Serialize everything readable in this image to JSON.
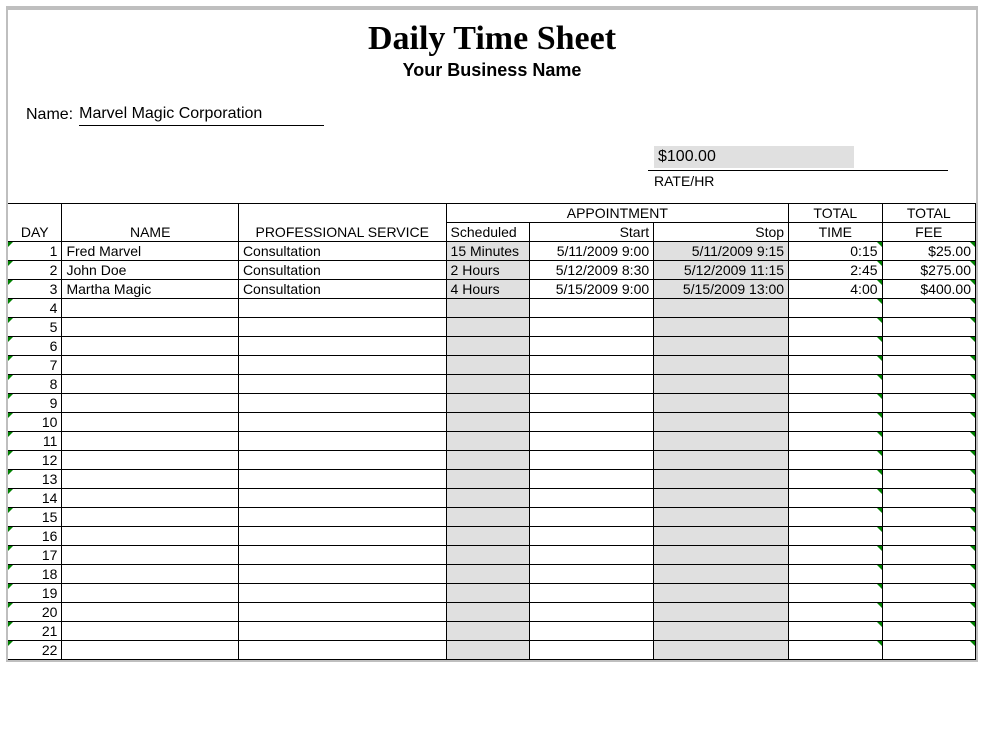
{
  "header": {
    "title": "Daily Time Sheet",
    "subtitle": "Your Business Name"
  },
  "name_field": {
    "label": "Name:",
    "value": "Marvel Magic Corporation"
  },
  "rate": {
    "value": "$100.00",
    "label": "RATE/HR"
  },
  "columns": {
    "day": "DAY",
    "name": "NAME",
    "service": "PROFESSIONAL SERVICE",
    "appointment": "APPOINTMENT",
    "scheduled": "Scheduled",
    "start": "Start",
    "stop": "Stop",
    "total_time": "TOTAL TIME",
    "total_fee": "TOTAL FEE"
  },
  "total_time_line1": "TOTAL",
  "total_time_line2": "TIME",
  "total_fee_line1": "TOTAL",
  "total_fee_line2": "FEE",
  "rows": [
    {
      "day": "1",
      "name": "Fred Marvel",
      "service": "Consultation",
      "scheduled": "15 Minutes",
      "start": "5/11/2009 9:00",
      "stop": "5/11/2009 9:15",
      "time": "0:15",
      "fee": "$25.00"
    },
    {
      "day": "2",
      "name": "John Doe",
      "service": "Consultation",
      "scheduled": "2 Hours",
      "start": "5/12/2009 8:30",
      "stop": "5/12/2009 11:15",
      "time": "2:45",
      "fee": "$275.00"
    },
    {
      "day": "3",
      "name": "Martha Magic",
      "service": "Consultation",
      "scheduled": "4 Hours",
      "start": "5/15/2009 9:00",
      "stop": "5/15/2009 13:00",
      "time": "4:00",
      "fee": "$400.00"
    },
    {
      "day": "4",
      "name": "",
      "service": "",
      "scheduled": "",
      "start": "",
      "stop": "",
      "time": "",
      "fee": ""
    },
    {
      "day": "5",
      "name": "",
      "service": "",
      "scheduled": "",
      "start": "",
      "stop": "",
      "time": "",
      "fee": ""
    },
    {
      "day": "6",
      "name": "",
      "service": "",
      "scheduled": "",
      "start": "",
      "stop": "",
      "time": "",
      "fee": ""
    },
    {
      "day": "7",
      "name": "",
      "service": "",
      "scheduled": "",
      "start": "",
      "stop": "",
      "time": "",
      "fee": ""
    },
    {
      "day": "8",
      "name": "",
      "service": "",
      "scheduled": "",
      "start": "",
      "stop": "",
      "time": "",
      "fee": ""
    },
    {
      "day": "9",
      "name": "",
      "service": "",
      "scheduled": "",
      "start": "",
      "stop": "",
      "time": "",
      "fee": ""
    },
    {
      "day": "10",
      "name": "",
      "service": "",
      "scheduled": "",
      "start": "",
      "stop": "",
      "time": "",
      "fee": ""
    },
    {
      "day": "11",
      "name": "",
      "service": "",
      "scheduled": "",
      "start": "",
      "stop": "",
      "time": "",
      "fee": ""
    },
    {
      "day": "12",
      "name": "",
      "service": "",
      "scheduled": "",
      "start": "",
      "stop": "",
      "time": "",
      "fee": ""
    },
    {
      "day": "13",
      "name": "",
      "service": "",
      "scheduled": "",
      "start": "",
      "stop": "",
      "time": "",
      "fee": ""
    },
    {
      "day": "14",
      "name": "",
      "service": "",
      "scheduled": "",
      "start": "",
      "stop": "",
      "time": "",
      "fee": ""
    },
    {
      "day": "15",
      "name": "",
      "service": "",
      "scheduled": "",
      "start": "",
      "stop": "",
      "time": "",
      "fee": ""
    },
    {
      "day": "16",
      "name": "",
      "service": "",
      "scheduled": "",
      "start": "",
      "stop": "",
      "time": "",
      "fee": ""
    },
    {
      "day": "17",
      "name": "",
      "service": "",
      "scheduled": "",
      "start": "",
      "stop": "",
      "time": "",
      "fee": ""
    },
    {
      "day": "18",
      "name": "",
      "service": "",
      "scheduled": "",
      "start": "",
      "stop": "",
      "time": "",
      "fee": ""
    },
    {
      "day": "19",
      "name": "",
      "service": "",
      "scheduled": "",
      "start": "",
      "stop": "",
      "time": "",
      "fee": ""
    },
    {
      "day": "20",
      "name": "",
      "service": "",
      "scheduled": "",
      "start": "",
      "stop": "",
      "time": "",
      "fee": ""
    },
    {
      "day": "21",
      "name": "",
      "service": "",
      "scheduled": "",
      "start": "",
      "stop": "",
      "time": "",
      "fee": ""
    },
    {
      "day": "22",
      "name": "",
      "service": "",
      "scheduled": "",
      "start": "",
      "stop": "",
      "time": "",
      "fee": ""
    }
  ]
}
